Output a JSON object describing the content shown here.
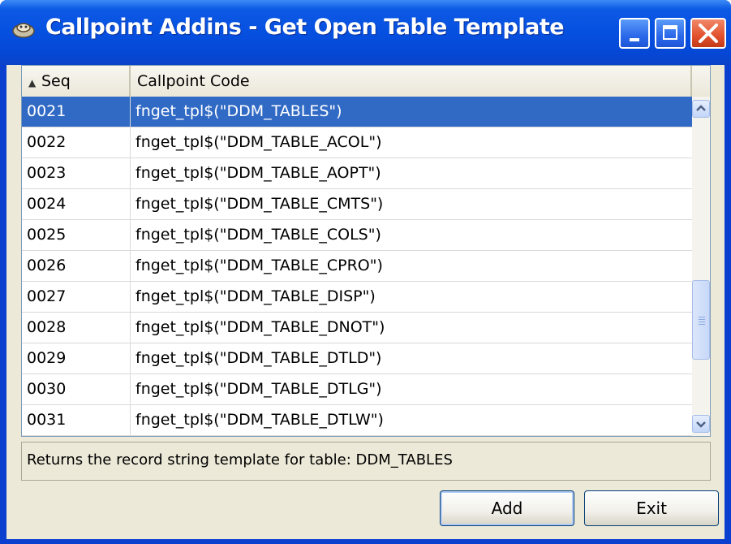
{
  "window": {
    "title": "Callpoint Addins - Get Open Table Template"
  },
  "grid": {
    "columns": [
      "Seq",
      "Callpoint Code"
    ],
    "sort_indicator": "▲",
    "selected_seq": "0021",
    "rows": [
      {
        "seq": "0021",
        "code": "fnget_tpl$(\"DDM_TABLES\")"
      },
      {
        "seq": "0022",
        "code": "fnget_tpl$(\"DDM_TABLE_ACOL\")"
      },
      {
        "seq": "0023",
        "code": "fnget_tpl$(\"DDM_TABLE_AOPT\")"
      },
      {
        "seq": "0024",
        "code": "fnget_tpl$(\"DDM_TABLE_CMTS\")"
      },
      {
        "seq": "0025",
        "code": "fnget_tpl$(\"DDM_TABLE_COLS\")"
      },
      {
        "seq": "0026",
        "code": "fnget_tpl$(\"DDM_TABLE_CPRO\")"
      },
      {
        "seq": "0027",
        "code": "fnget_tpl$(\"DDM_TABLE_DISP\")"
      },
      {
        "seq": "0028",
        "code": "fnget_tpl$(\"DDM_TABLE_DNOT\")"
      },
      {
        "seq": "0029",
        "code": "fnget_tpl$(\"DDM_TABLE_DTLD\")"
      },
      {
        "seq": "0030",
        "code": "fnget_tpl$(\"DDM_TABLE_DTLG\")"
      },
      {
        "seq": "0031",
        "code": "fnget_tpl$(\"DDM_TABLE_DTLW\")"
      }
    ]
  },
  "status": {
    "text": "Returns the record string template for table: DDM_TABLES"
  },
  "buttons": {
    "add": "Add",
    "exit": "Exit"
  },
  "colors": {
    "selection": "#316ac5",
    "titlebar": "#0650e0",
    "client_bg": "#ece9d8"
  }
}
